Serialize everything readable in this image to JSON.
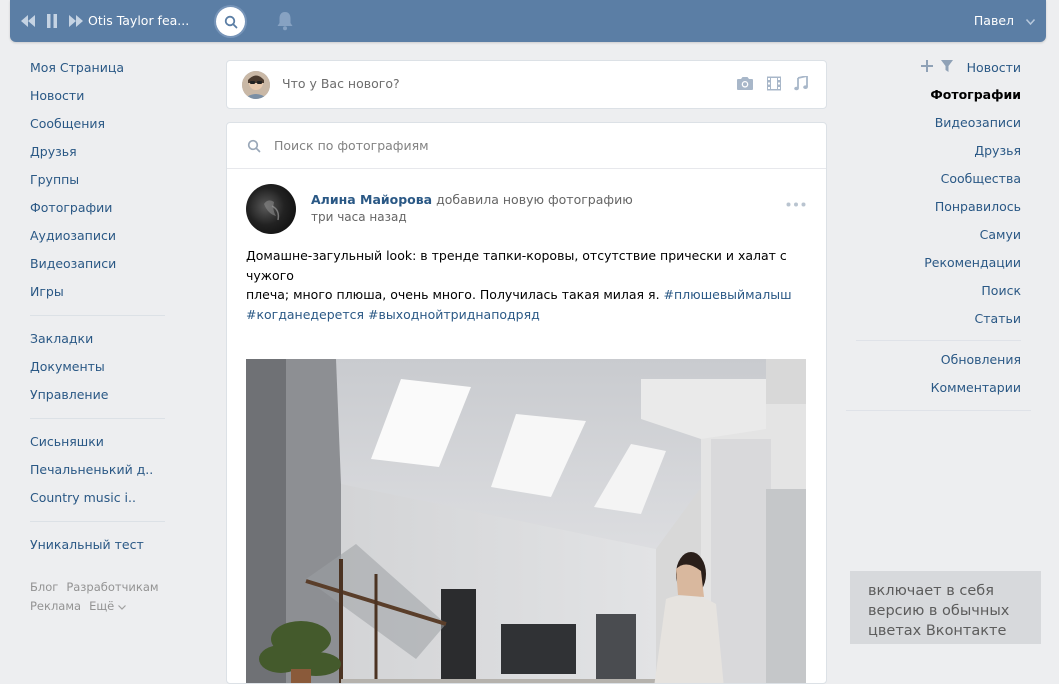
{
  "header": {
    "track_title": "Otis Taylor fea...",
    "user_name": "Павел",
    "icons": [
      "prev-icon",
      "pause-icon",
      "next-icon",
      "search-icon",
      "bell-icon",
      "chevron-down-icon"
    ]
  },
  "left_nav": {
    "main": [
      "Моя Страница",
      "Новости",
      "Сообщения",
      "Друзья",
      "Группы",
      "Фотографии",
      "Аудиозаписи",
      "Видеозаписи",
      "Игры"
    ],
    "secondary": [
      "Закладки",
      "Документы",
      "Управление"
    ],
    "groups": [
      "Сисьняшки",
      "Печальненький д..",
      "Country music i.."
    ],
    "apps": [
      "Уникальный тест"
    ],
    "footer": [
      "Блог",
      "Разработчикам",
      "Реклама",
      "Ещё"
    ]
  },
  "post_box": {
    "placeholder": "Что у Вас нового?",
    "icons": [
      "camera-icon",
      "video-icon",
      "music-icon"
    ]
  },
  "photo_search": {
    "placeholder": "Поиск по фотографиям"
  },
  "post": {
    "author": "Алина Майорова",
    "action": "добавила новую фотографию",
    "time": "три часа назад",
    "text_line1": "Домашне-загульный look: в тренде тапки-коровы, отсутствие прически и халат с чужого",
    "text_line2": "плеча; много плюша, очень много. Получилась такая милая я.",
    "tag1": "#плюшевыймалыш",
    "tag2": "#когданедерется",
    "tag3": "#выходнойтриднаподряд"
  },
  "right_nav": {
    "items": [
      "Новости",
      "Фотографии",
      "Видеозаписи",
      "Друзья",
      "Сообщества",
      "Понравилось",
      "Самуи",
      "Рекомендации",
      "Поиск",
      "Статьи"
    ],
    "active": "Фотографии",
    "extra": [
      "Обновления",
      "Комментарии"
    ]
  },
  "caption": {
    "line1": "включает в себя",
    "line2": "версию в обычных",
    "line3": "цветах Вконтакте"
  },
  "colors": {
    "header": "#5b7ea5",
    "link": "#2a5885",
    "background": "#edeef0"
  }
}
